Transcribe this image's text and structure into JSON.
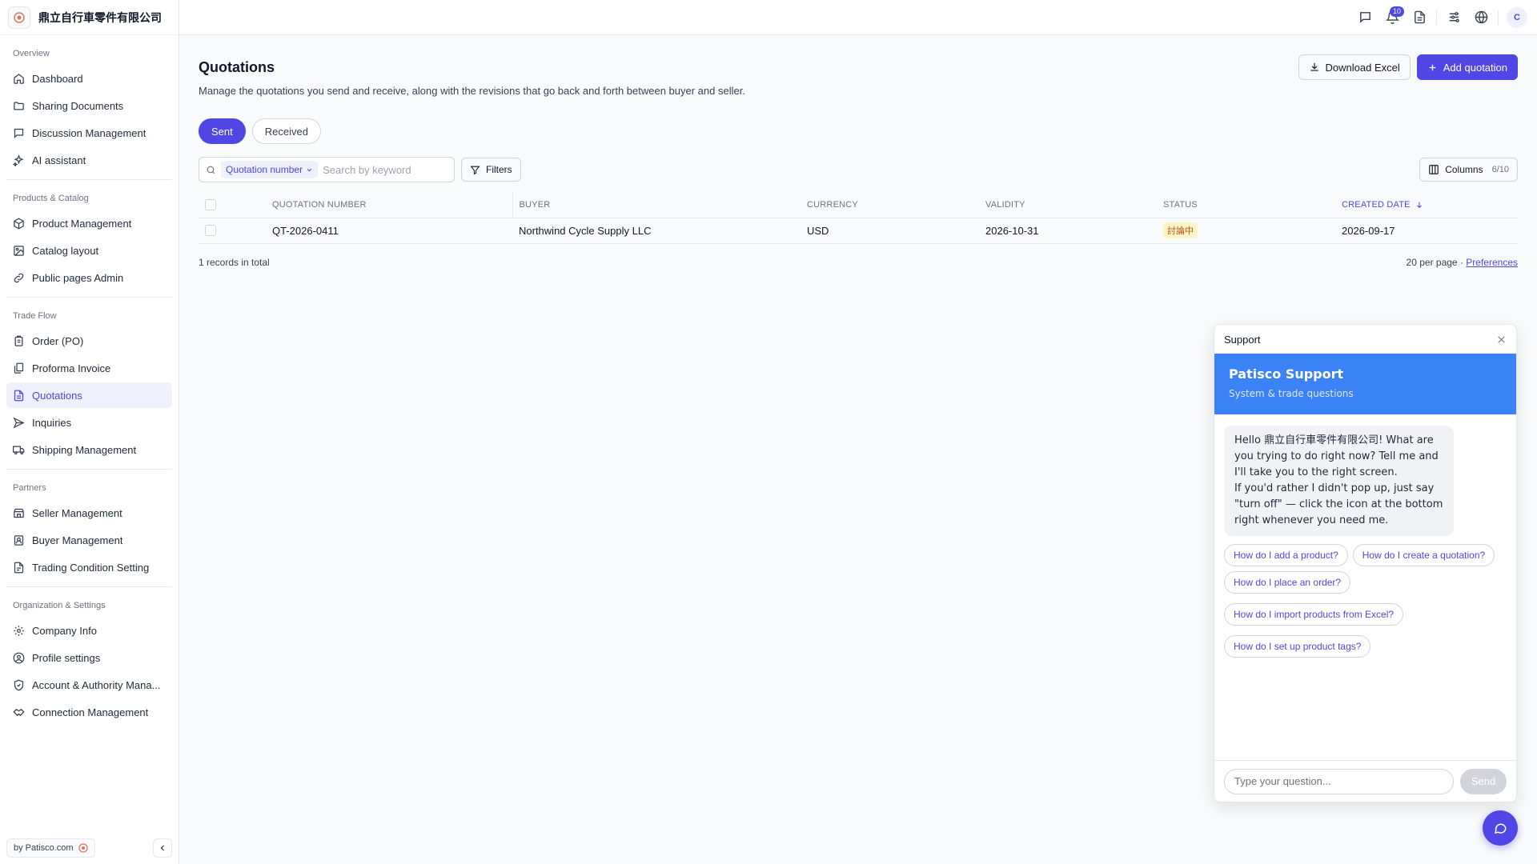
{
  "brand": {
    "name": "鼎立自行車零件有限公司"
  },
  "sidebar": {
    "sections": [
      {
        "title": "Overview",
        "items": [
          {
            "label": "Dashboard",
            "icon": "home-icon"
          },
          {
            "label": "Sharing Documents",
            "icon": "folder-icon"
          },
          {
            "label": "Discussion Management",
            "icon": "message-square-icon"
          },
          {
            "label": "AI assistant",
            "icon": "sparkles-icon"
          }
        ]
      },
      {
        "title": "Products & Catalog",
        "items": [
          {
            "label": "Product Management",
            "icon": "package-icon"
          },
          {
            "label": "Catalog layout",
            "icon": "image-icon"
          },
          {
            "label": "Public pages Admin",
            "icon": "link-icon"
          }
        ]
      },
      {
        "title": "Trade Flow",
        "items": [
          {
            "label": "Order (PO)",
            "icon": "clipboard-icon"
          },
          {
            "label": "Proforma Invoice",
            "icon": "files-icon"
          },
          {
            "label": "Quotations",
            "icon": "file-text-icon",
            "active": true
          },
          {
            "label": "Inquiries",
            "icon": "send-icon"
          },
          {
            "label": "Shipping Management",
            "icon": "truck-icon"
          }
        ]
      },
      {
        "title": "Partners",
        "items": [
          {
            "label": "Seller Management",
            "icon": "store-icon"
          },
          {
            "label": "Buyer Management",
            "icon": "contact-icon"
          },
          {
            "label": "Trading Condition Setting",
            "icon": "file-icon"
          }
        ]
      },
      {
        "title": "Organization & Settings",
        "items": [
          {
            "label": "Company Info",
            "icon": "gear-icon"
          },
          {
            "label": "Profile settings",
            "icon": "user-circle-icon"
          },
          {
            "label": "Account & Authority Mana...",
            "icon": "shield-icon"
          },
          {
            "label": "Connection Management",
            "icon": "handshake-icon"
          }
        ]
      }
    ],
    "footer": {
      "by_label": "by Patisco.com"
    }
  },
  "topbar": {
    "notification_count": "10",
    "avatar_initial": "C"
  },
  "page": {
    "title": "Quotations",
    "description": "Manage the quotations you send and receive, along with the revisions that go back and forth between buyer and seller.",
    "download_label": "Download Excel",
    "add_label": "Add quotation",
    "tabs": [
      "Sent",
      "Received"
    ],
    "active_tab": "Sent"
  },
  "filters": {
    "field_label": "Quotation number",
    "search_placeholder": "Search by keyword",
    "filters_label": "Filters",
    "columns_label": "Columns",
    "columns_count": "6/10"
  },
  "table": {
    "headers": [
      "QUOTATION NUMBER",
      "BUYER",
      "CURRENCY",
      "VALIDITY",
      "STATUS",
      "CREATED DATE"
    ],
    "sorted_column": "CREATED DATE",
    "rows": [
      {
        "quotation_number": "QT-2026-0411",
        "buyer": "Northwind Cycle Supply LLC",
        "currency": "USD",
        "validity": "2026-10-31",
        "status": "討論中",
        "created_date": "2026-09-17"
      }
    ],
    "total_label": "1 records in total",
    "per_page_label": "20 per page",
    "separator": "·",
    "preferences_label": "Preferences"
  },
  "support": {
    "header_title": "Support",
    "banner_title": "Patisco Support",
    "banner_subtitle": "System & trade questions",
    "message": "Hello 鼎立自行車零件有限公司! What are you trying to do right now? Tell me and I'll take you to the right screen.\nIf you'd rather I didn't pop up, just say \"turn off\" — click the icon at the bottom right whenever you need me.",
    "suggestions": [
      "How do I add a product?",
      "How do I create a quotation?",
      "How do I place an order?",
      "How do I import products from Excel?",
      "How do I set up product tags?"
    ],
    "input_placeholder": "Type your question...",
    "send_label": "Send"
  },
  "colors": {
    "accent": "#4f46e5",
    "banner": "#3b82f6",
    "status_bg": "#fef3c7",
    "status_fg": "#b45309"
  }
}
